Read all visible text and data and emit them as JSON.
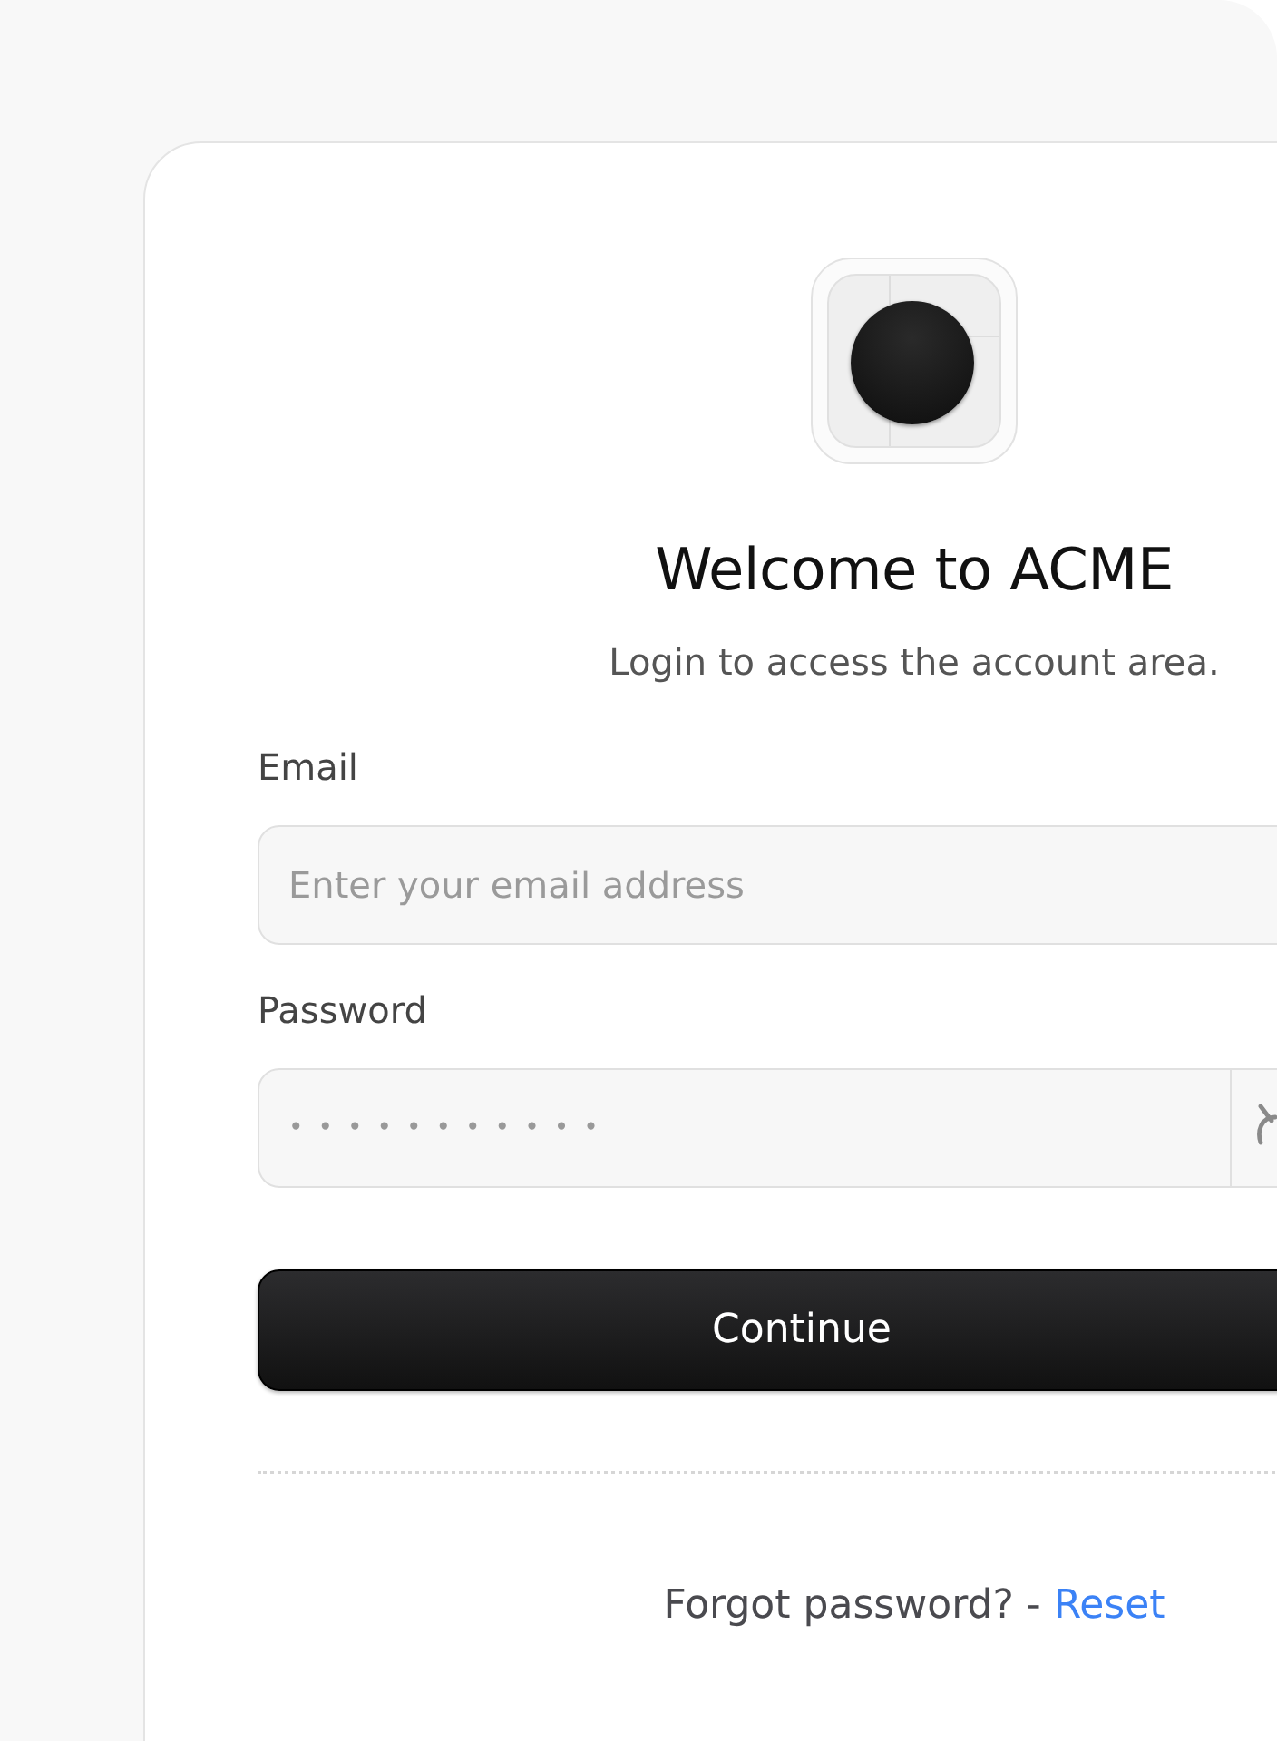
{
  "title": "Welcome to ACME",
  "subtitle": "Login to access the account area.",
  "fields": [
    {
      "label": "Email",
      "placeholder": "Enter your email address",
      "kind": "text"
    },
    {
      "label": "Password",
      "value": "•••••••••••",
      "kind": "password"
    }
  ],
  "button": "Continue",
  "footer": {
    "text": "Forgot password? -",
    "link": "Reset"
  }
}
